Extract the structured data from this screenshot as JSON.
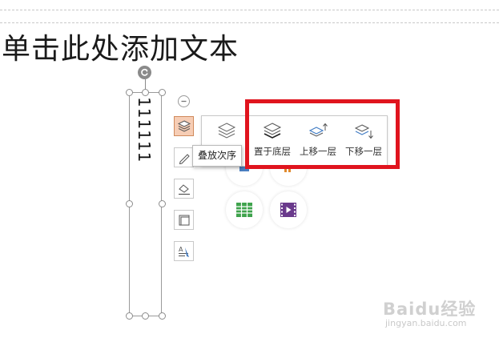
{
  "slide": {
    "title_placeholder": "单击此处添加文本",
    "textbox_text": "111111"
  },
  "toolbar": {
    "tools": [
      {
        "name": "layer-order",
        "icon": "layers-icon",
        "active": true
      },
      {
        "name": "pen",
        "icon": "pen-icon"
      },
      {
        "name": "fill",
        "icon": "fill-bucket-icon"
      },
      {
        "name": "border",
        "icon": "frame-icon"
      },
      {
        "name": "text-format",
        "icon": "text-format-icon"
      }
    ],
    "tooltip": "叠放次序"
  },
  "layer_menu": {
    "items": [
      {
        "label": "",
        "icon": "stack-icon"
      },
      {
        "label": "置于底层",
        "icon": "send-to-back-icon"
      },
      {
        "label": "上移一层",
        "icon": "bring-forward-icon"
      },
      {
        "label": "下移一层",
        "icon": "send-backward-icon"
      }
    ]
  },
  "insert_buttons": [
    {
      "icon": "table-icon",
      "color": "#3fa34d"
    },
    {
      "icon": "video-icon",
      "color": "#6a3a8c"
    }
  ],
  "colors": {
    "highlight": "#e0141e",
    "active_tool_bg": "#f6cdb5",
    "table_green": "#3fa34d",
    "video_purple": "#6a3a8c"
  },
  "watermark": {
    "logo": "Baidu经验",
    "url": "jingyan.baidu.com"
  }
}
